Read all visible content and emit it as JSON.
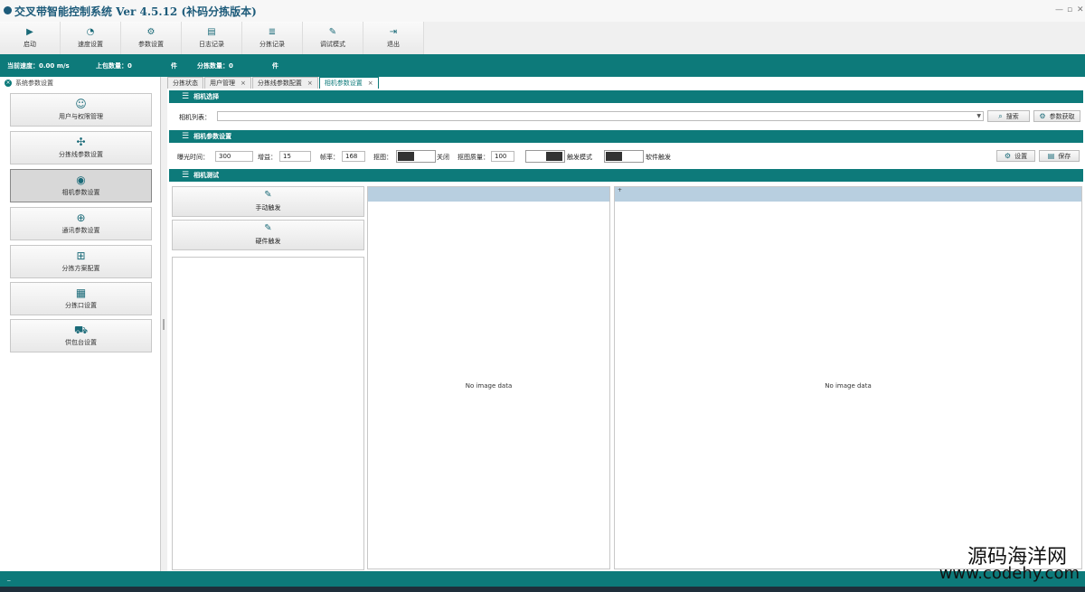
{
  "window": {
    "title": "交叉带智能控制系统 Ver 4.5.12 (补码分拣版本)",
    "min": "—",
    "max": "▫",
    "close": "✕"
  },
  "toolbar": [
    {
      "label": "启动",
      "icon": "play-icon",
      "glyph": "▶"
    },
    {
      "label": "速度设置",
      "icon": "gauge-icon",
      "glyph": "◔"
    },
    {
      "label": "参数设置",
      "icon": "params-icon",
      "glyph": "⚙"
    },
    {
      "label": "日志记录",
      "icon": "printer-icon",
      "glyph": "▤"
    },
    {
      "label": "分拣记录",
      "icon": "database-icon",
      "glyph": "≣"
    },
    {
      "label": "调试模式",
      "icon": "wrench-icon",
      "glyph": "✎"
    },
    {
      "label": "退出",
      "icon": "exit-icon",
      "glyph": "⇥"
    }
  ],
  "status": {
    "speed_label": "当前速度：0.00 m/s",
    "upload_label": "上包数量：0",
    "upload_unit": "件",
    "sort_label": "分拣数量：0",
    "sort_unit": "件"
  },
  "sidebar": {
    "header": "系统参数设置",
    "items": [
      {
        "label": "用户与权限管理",
        "icon": "users-icon",
        "glyph": "☺"
      },
      {
        "label": "分拣线参数设置",
        "icon": "network-icon",
        "glyph": "✣"
      },
      {
        "label": "相机参数设置",
        "icon": "camera-icon",
        "glyph": "◉"
      },
      {
        "label": "通讯参数设置",
        "icon": "globe-icon",
        "glyph": "⊕"
      },
      {
        "label": "分拣方案配置",
        "icon": "flowchart-icon",
        "glyph": "⊞"
      },
      {
        "label": "分拣口设置",
        "icon": "grid-icon",
        "glyph": "▦"
      },
      {
        "label": "供包台设置",
        "icon": "forklift-icon",
        "glyph": "⛟"
      }
    ]
  },
  "tabs": [
    {
      "label": "分拣状态",
      "closable": false
    },
    {
      "label": "用户管理",
      "closable": true
    },
    {
      "label": "分拣线参数配置",
      "closable": true
    },
    {
      "label": "相机参数设置",
      "closable": true
    }
  ],
  "tab_close": "×",
  "camera_select": {
    "title": "相机选择",
    "list_label": "相机列表：",
    "value": "",
    "search_button": "搜索",
    "fetch_button": "参数获取"
  },
  "camera_params": {
    "title": "相机参数设置",
    "exposure_label": "曝光时间：",
    "exposure_value": "300",
    "gain_label": "增益：",
    "gain_value": "15",
    "framerate_label": "帧率：",
    "framerate_value": "168",
    "capture_label": "抠图：",
    "capture_state": "关闭",
    "quality_label": "抠图质量：",
    "quality_value": "100",
    "trigger_mode_label": "触发模式",
    "soft_trigger_label": "软件触发",
    "settings_button": "设置",
    "save_button": "保存"
  },
  "camera_test": {
    "title": "相机测试",
    "manual_trigger": "手动触发",
    "hardware_trigger": "硬件触发",
    "image_left_header": "",
    "image_right_header": "+",
    "no_image_left": "No image data",
    "no_image_right": "No image data"
  },
  "bottom": {
    "text": "_"
  },
  "watermark": {
    "line1": "源码海洋网",
    "line2": "www.codehy.com"
  }
}
